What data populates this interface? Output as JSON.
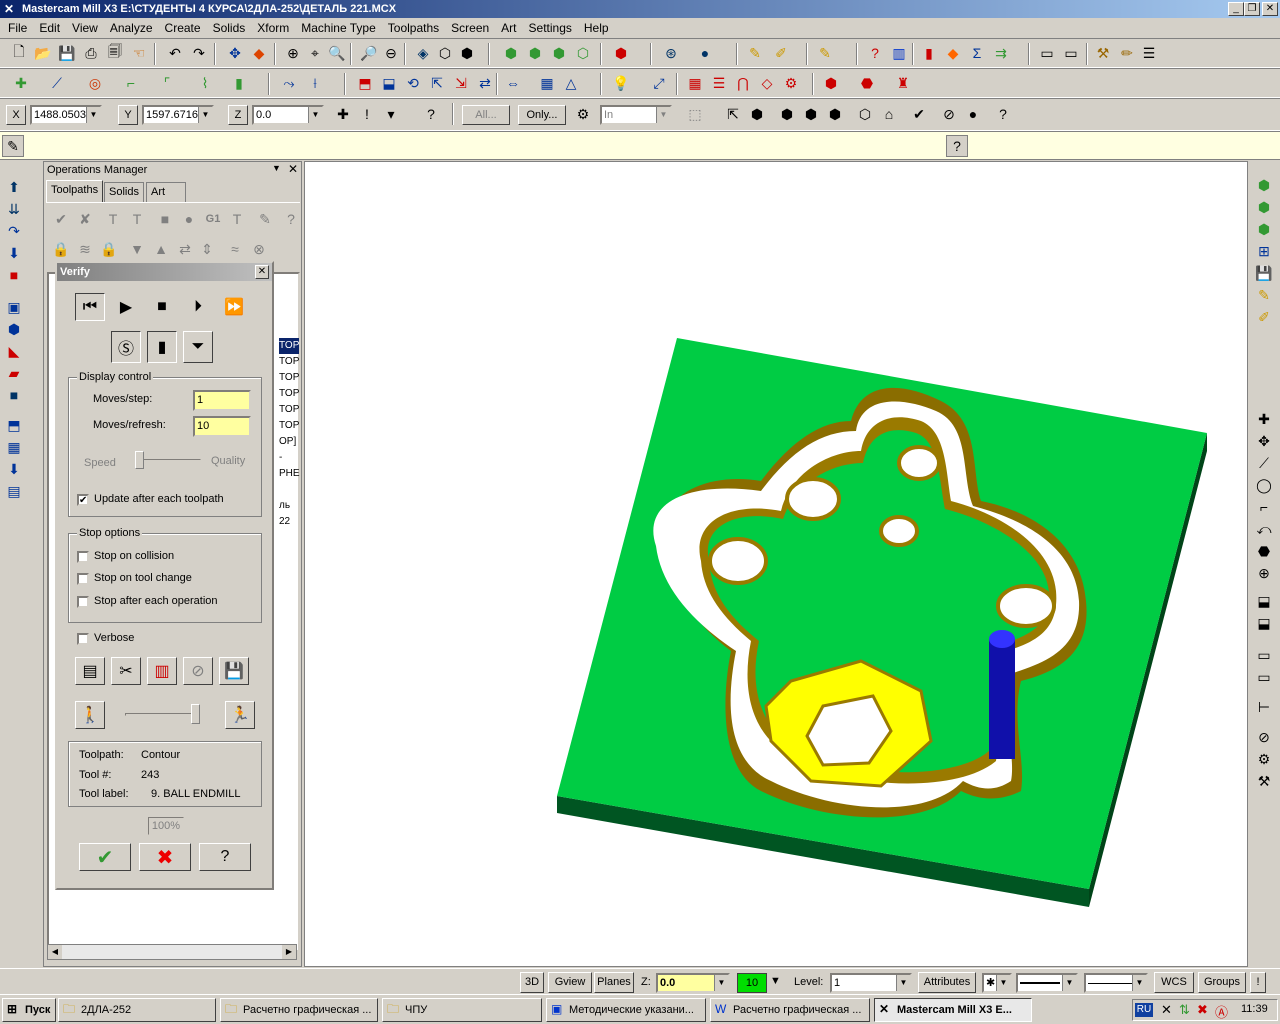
{
  "window": {
    "title": "Mastercam Mill X3  E:\\СТУДЕНТЫ 4 КУРСА\\2ДЛА-252\\ДЕТАЛЬ 221.MCX"
  },
  "menu": [
    "File",
    "Edit",
    "View",
    "Analyze",
    "Create",
    "Solids",
    "Xform",
    "Machine Type",
    "Toolpaths",
    "Screen",
    "Art",
    "Settings",
    "Help"
  ],
  "coords": {
    "x_label": "X",
    "x_value": "1488.0503",
    "y_label": "Y",
    "y_value": "1597.6716",
    "z_label": "Z",
    "z_value": "0.0",
    "all_btn": "All...",
    "only_btn": "Only...",
    "in_value": "In"
  },
  "ops": {
    "title": "Operations Manager",
    "tabs": [
      "Toolpaths",
      "Solids",
      "Art"
    ],
    "list_rows": [
      "TOP",
      "TOP",
      "TOP",
      "TOP",
      "TOP",
      "TOP",
      "OP] -",
      "",
      "PHE",
      "",
      "ль 22"
    ]
  },
  "verify": {
    "title": "Verify",
    "display_control": "Display control",
    "moves_step_label": "Moves/step:",
    "moves_step_value": "1",
    "moves_refresh_label": "Moves/refresh:",
    "moves_refresh_value": "10",
    "speed": "Speed",
    "quality": "Quality",
    "update_each": "Update after each toolpath",
    "stop_options": "Stop options",
    "stop_collision": "Stop on collision",
    "stop_tool_change": "Stop on tool change",
    "stop_each_op": "Stop after each operation",
    "verbose": "Verbose",
    "toolpath_label": "Toolpath:",
    "toolpath_value": "Contour",
    "tool_num_label": "Tool #:",
    "tool_num_value": "243",
    "tool_label_label": "Tool label:",
    "tool_label_value": "9. BALL ENDMILL",
    "percent": "100%"
  },
  "status": {
    "view_3d": "3D",
    "gview": "Gview",
    "planes": "Planes",
    "z_label": "Z:",
    "z_value": "0.0",
    "color_value": "10",
    "level_label": "Level:",
    "level_value": "1",
    "attributes": "Attributes",
    "wcs": "WCS",
    "groups": "Groups",
    "excl": "!"
  },
  "taskbar": {
    "start": "Пуск",
    "tasks": [
      "2ДЛА-252",
      "Расчетно графическая ...",
      "ЧПУ",
      "Методические указани...",
      "Расчетно графическая ...",
      "Mastercam Mill X3  E..."
    ],
    "lang": "RU",
    "clock": "11:39"
  },
  "colors": {
    "stock": "#00cc44",
    "wall": "#9a7a00",
    "floor": "#ffff00",
    "tool": "#1010aa"
  }
}
